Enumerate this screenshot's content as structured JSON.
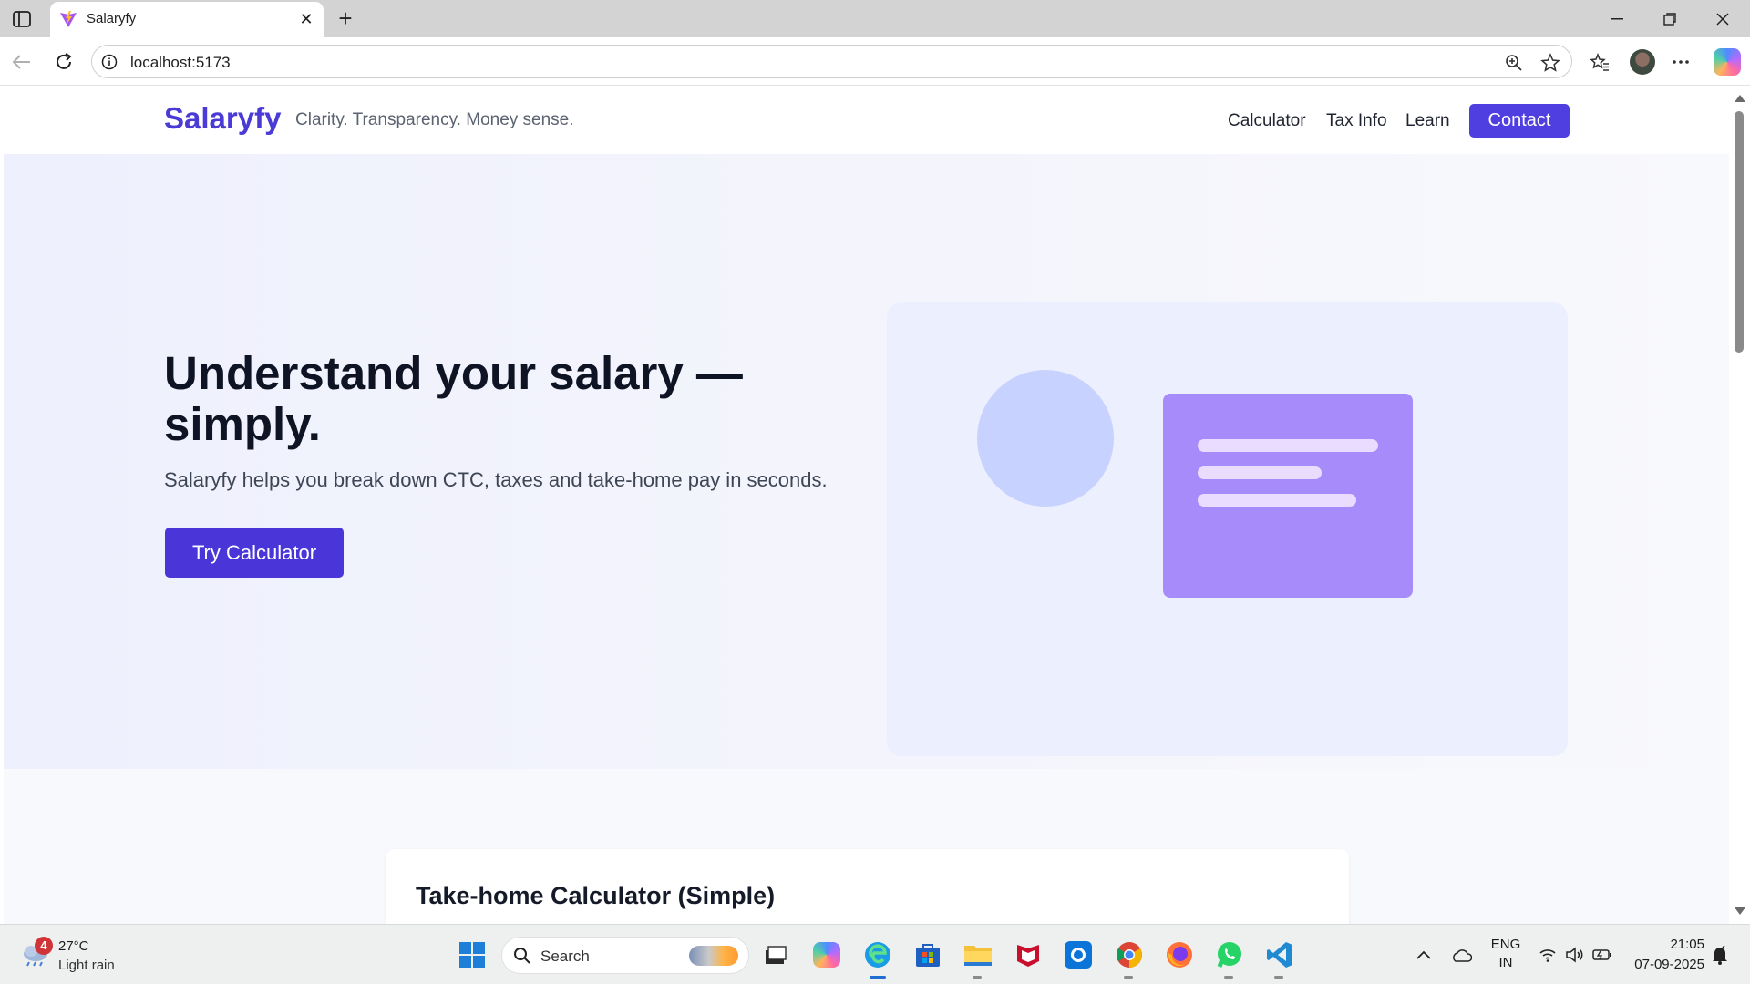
{
  "browser": {
    "tab_title": "Salaryfy",
    "url": "localhost:5173"
  },
  "site": {
    "brand": "Salaryfy",
    "tagline": "Clarity. Transparency. Money sense.",
    "nav": {
      "calculator": "Calculator",
      "tax_info": "Tax Info",
      "learn": "Learn",
      "contact": "Contact"
    },
    "hero": {
      "title": "Understand your salary — simply.",
      "subtitle": "Salaryfy helps you break down CTC, taxes and take-home pay in seconds.",
      "cta": "Try Calculator"
    },
    "calculator": {
      "title": "Take-home Calculator (Simple)"
    },
    "colors": {
      "brand": "#4a3ad6",
      "primary_button": "#4f3ee0",
      "illustration_bg": "#eceffd",
      "illustration_circle": "#c7d2fe",
      "illustration_card": "#a78bfa"
    }
  },
  "taskbar": {
    "weather": {
      "badge": "4",
      "temp": "27°C",
      "desc": "Light rain"
    },
    "search_placeholder": "Search",
    "language": "ENG",
    "region": "IN",
    "time": "21:05",
    "date": "07-09-2025",
    "apps": [
      "start-icon",
      "search-icon",
      "task-view-icon",
      "copilot-icon",
      "edge-icon",
      "store-icon",
      "file-explorer-icon",
      "mcafee-icon",
      "app-icon",
      "chrome-icon",
      "firefox-icon",
      "whatsapp-icon",
      "vscode-icon"
    ]
  }
}
